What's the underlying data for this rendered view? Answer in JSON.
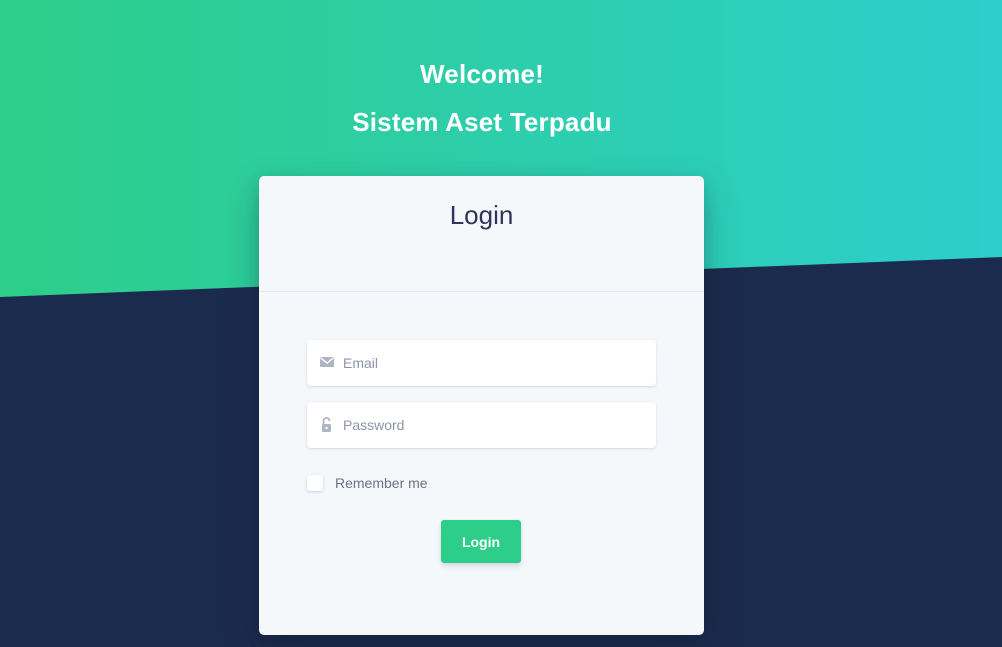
{
  "header": {
    "welcome": "Welcome!",
    "subtitle": "Sistem Aset Terpadu"
  },
  "login_card": {
    "title": "Login",
    "email": {
      "icon": "envelope-icon",
      "placeholder": "Email",
      "value": ""
    },
    "password": {
      "icon": "unlock-icon",
      "placeholder": "Password",
      "value": ""
    },
    "remember_label": "Remember me",
    "remember_checked": false,
    "submit_label": "Login"
  },
  "colors": {
    "accent_green": "#2dce89",
    "accent_teal": "#2dcecc",
    "dark_navy": "#1b2b4d",
    "card_bg": "#f5f8fb",
    "title_text": "#32325d"
  }
}
